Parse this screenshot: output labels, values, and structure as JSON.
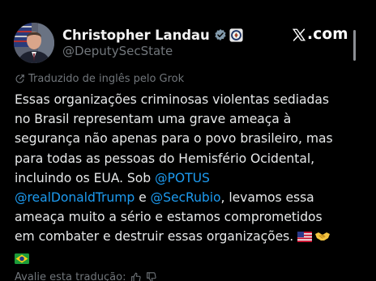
{
  "author": {
    "display_name": "Christopher Landau",
    "handle": "@DeputySecState",
    "verified_icon": "verified-badge-icon",
    "affiliation_icon": "state-department-seal-icon"
  },
  "brand": {
    "domain": ".com",
    "logo": "x-logo-icon"
  },
  "translation_notice": "Traduzido de inglês pelo Grok",
  "post": {
    "l1": "Essas organizações criminosas violentas sediadas",
    "l2": "no Brasil representam uma grave ameaça à",
    "l3": "segurança não apenas para o povo brasileiro, mas",
    "l4": "para todas as pessoas do Hemisfério Ocidental,",
    "l5": "incluindo os EUA. Sob ",
    "mention_potus": "@POTUS",
    "mention_trump": "@realDonaldTrump",
    "l6_mid": " e ",
    "mention_rubio": "@SecRubio",
    "l6_end": ", levamos essa",
    "l7": "ameaça muito a sério e estamos comprometidos",
    "l8": "em combater e destruir essas organizações. ",
    "emojis": [
      "us-flag-icon",
      "handshake-icon",
      "brazil-flag-icon"
    ]
  },
  "rate_prompt": "Avalie esta tradução:",
  "colors": {
    "background": "#000000",
    "text": "#e7e9ea",
    "secondary": "#71767b",
    "mention": "#1d9bf0",
    "verified": "#829aab"
  }
}
